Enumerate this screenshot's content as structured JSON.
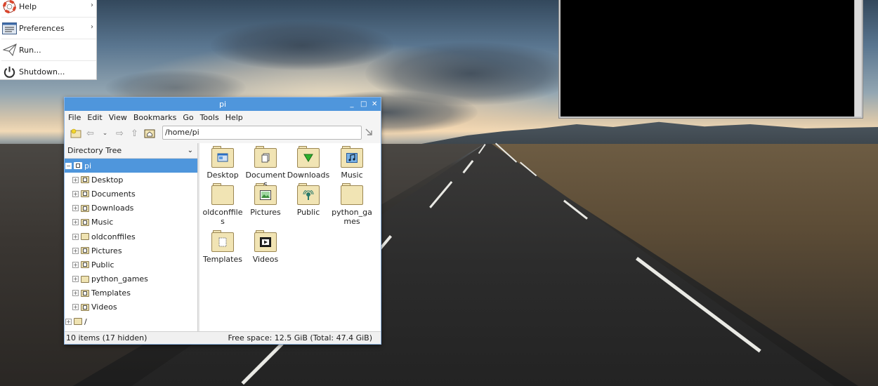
{
  "start_menu": {
    "items": [
      {
        "label": "Help",
        "icon": "lifebuoy-icon",
        "has_submenu": true
      },
      {
        "label": "Preferences",
        "icon": "preferences-icon",
        "has_submenu": true
      },
      {
        "label": "Run...",
        "icon": "paper-plane-icon",
        "has_submenu": false
      },
      {
        "label": "Shutdown...",
        "icon": "power-icon",
        "has_submenu": false
      }
    ]
  },
  "file_manager": {
    "title": "pi",
    "window_buttons": {
      "minimize": "_",
      "maximize": "□",
      "close": "✕"
    },
    "menubar": [
      "File",
      "Edit",
      "View",
      "Bookmarks",
      "Go",
      "Tools",
      "Help"
    ],
    "path": "/home/pi",
    "sidebar_mode": "Directory Tree",
    "tree": [
      {
        "label": "pi",
        "expander": "−",
        "selected": true,
        "indent": 0
      },
      {
        "label": "Desktop",
        "expander": "+",
        "selected": false,
        "indent": 1
      },
      {
        "label": "Documents",
        "expander": "+",
        "selected": false,
        "indent": 1
      },
      {
        "label": "Downloads",
        "expander": "+",
        "selected": false,
        "indent": 1
      },
      {
        "label": "Music",
        "expander": "+",
        "selected": false,
        "indent": 1
      },
      {
        "label": "oldconffiles",
        "expander": "+",
        "selected": false,
        "indent": 1
      },
      {
        "label": "Pictures",
        "expander": "+",
        "selected": false,
        "indent": 1
      },
      {
        "label": "Public",
        "expander": "+",
        "selected": false,
        "indent": 1
      },
      {
        "label": "python_games",
        "expander": "+",
        "selected": false,
        "indent": 1
      },
      {
        "label": "Templates",
        "expander": "+",
        "selected": false,
        "indent": 1
      },
      {
        "label": "Videos",
        "expander": "+",
        "selected": false,
        "indent": 1
      },
      {
        "label": "/",
        "expander": "+",
        "selected": false,
        "indent": 0
      }
    ],
    "files": [
      {
        "name": "Desktop",
        "emblem": "desktop"
      },
      {
        "name": "Documents",
        "emblem": "documents"
      },
      {
        "name": "Downloads",
        "emblem": "downloads"
      },
      {
        "name": "Music",
        "emblem": "music"
      },
      {
        "name": "oldconffiles",
        "emblem": "none"
      },
      {
        "name": "Pictures",
        "emblem": "pictures"
      },
      {
        "name": "Public",
        "emblem": "public"
      },
      {
        "name": "python_games",
        "emblem": "none"
      },
      {
        "name": "Templates",
        "emblem": "templates"
      },
      {
        "name": "Videos",
        "emblem": "videos"
      }
    ],
    "status_left": "10 items (17 hidden)",
    "status_right": "Free space: 12.5 GiB (Total: 47.4 GiB)"
  },
  "colors": {
    "titlebar": "#4f96dc",
    "selection": "#4f96dc",
    "folder": "#f1e4b4",
    "terminal_bg": "#000000"
  }
}
